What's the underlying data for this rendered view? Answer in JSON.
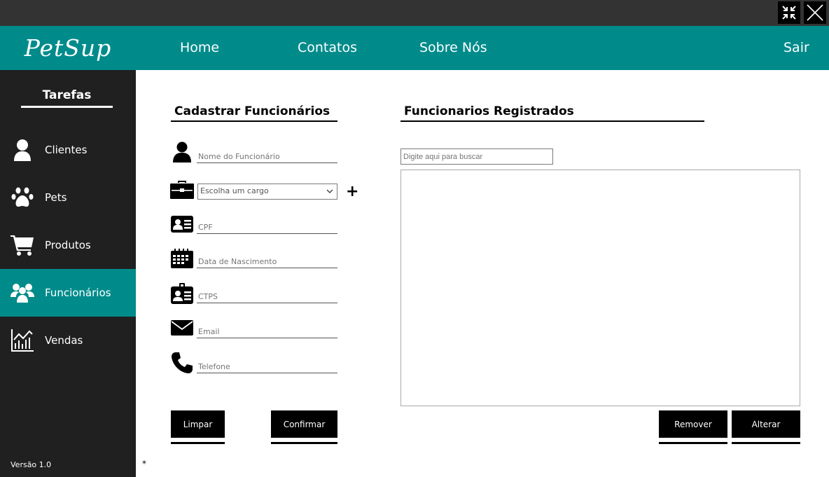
{
  "window": {
    "minimize_icon": "shrink-arrows-icon",
    "close_icon": "close-x-icon"
  },
  "app": {
    "logo": "PetSup",
    "version": "Versão 1.0"
  },
  "nav": {
    "home": "Home",
    "contatos": "Contatos",
    "sobre": "Sobre Nós",
    "sair": "Sair"
  },
  "sidebar": {
    "title": "Tarefas",
    "items": [
      {
        "label": "Clientes",
        "icon": "user-icon"
      },
      {
        "label": "Pets",
        "icon": "paw-icon"
      },
      {
        "label": "Produtos",
        "icon": "cart-icon"
      },
      {
        "label": "Funcionários",
        "icon": "group-icon",
        "active": true
      },
      {
        "label": "Vendas",
        "icon": "chart-icon"
      }
    ]
  },
  "form": {
    "title": "Cadastrar Funcionários",
    "nome_placeholder": "Nome do Funcionário",
    "cargo_placeholder": "Escolha um cargo",
    "add_cargo": "+",
    "cpf_placeholder": "CPF",
    "nascimento_placeholder": "Data de Nascimento",
    "ctps_placeholder": "CTPS",
    "email_placeholder": "Email",
    "telefone_placeholder": "Telefone",
    "limpar": "Limpar",
    "confirmar": "Confirmar"
  },
  "registered": {
    "title": "Funcionarios Registrados",
    "search_placeholder": "Digite aqui para buscar",
    "remover": "Remover",
    "alterar": "Alterar"
  },
  "footer": {
    "mark": "*"
  },
  "colors": {
    "accent": "#008B8B",
    "sidebar": "#202020",
    "titlebar": "#333333"
  }
}
